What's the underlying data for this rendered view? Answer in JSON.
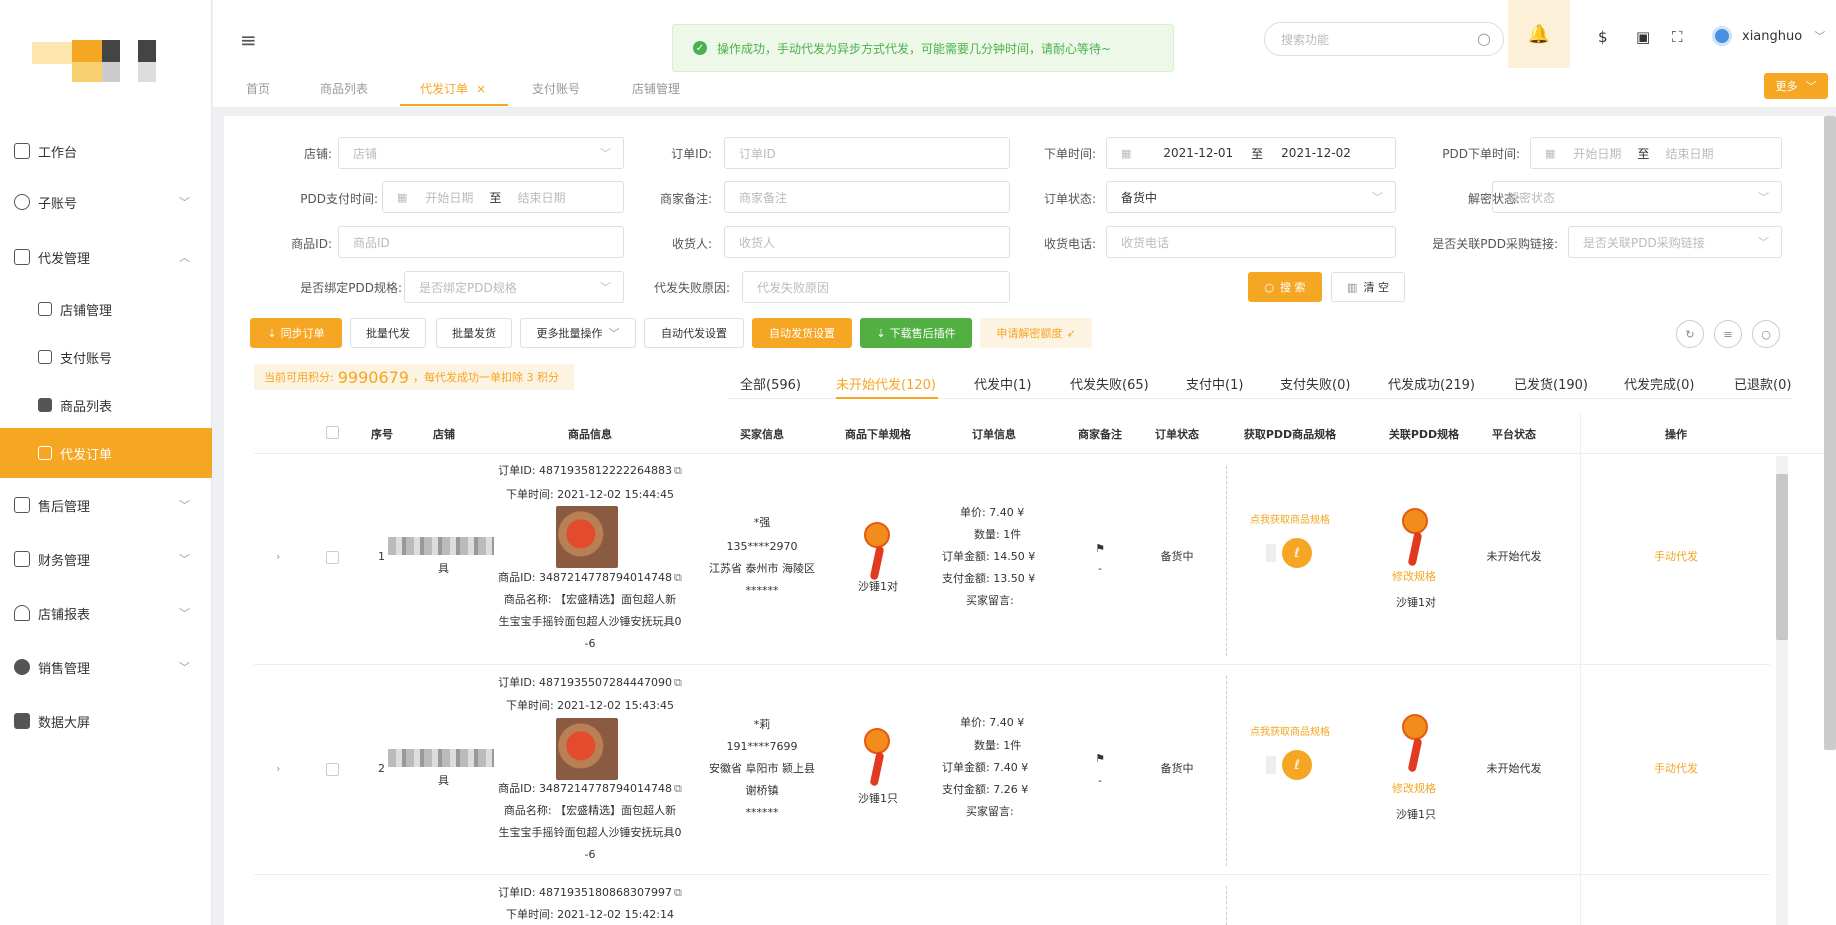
{
  "app": {
    "user": "xianghuo"
  },
  "header": {
    "toast": "操作成功，手动代发为异步方式代发，可能需要几分钟时间，请耐心等待~",
    "search_placeholder": "搜索功能",
    "more": "更多"
  },
  "page_tabs": [
    {
      "label": "首页"
    },
    {
      "label": "商品列表"
    },
    {
      "label": "代发订单",
      "close": "×"
    },
    {
      "label": "支付账号"
    },
    {
      "label": "店铺管理"
    }
  ],
  "sidebar": {
    "items": [
      {
        "label": "工作台"
      },
      {
        "label": "子账号"
      },
      {
        "label": "代发管理"
      },
      {
        "label": "店铺管理"
      },
      {
        "label": "支付账号"
      },
      {
        "label": "商品列表"
      },
      {
        "label": "代发订单"
      },
      {
        "label": "售后管理"
      },
      {
        "label": "财务管理"
      },
      {
        "label": "店铺报表"
      },
      {
        "label": "销售管理"
      },
      {
        "label": "数据大屏"
      }
    ]
  },
  "filters": {
    "shop": {
      "label": "店铺:",
      "placeholder": "店铺"
    },
    "order_id": {
      "label": "订单ID:",
      "placeholder": "订单ID"
    },
    "order_time": {
      "label": "下单时间:",
      "start": "2021-12-01",
      "end": "2021-12-02",
      "sep": "至"
    },
    "pdd_order_time": {
      "label": "PDD下单时间:",
      "start": "开始日期",
      "end": "结束日期",
      "sep": "至"
    },
    "pdd_pay_time": {
      "label": "PDD支付时间:",
      "start": "开始日期",
      "end": "结束日期",
      "sep": "至"
    },
    "merchant_note": {
      "label": "商家备注:",
      "placeholder": "商家备注"
    },
    "order_status": {
      "label": "订单状态:",
      "value": "备货中"
    },
    "decrypt_status": {
      "label": "解密状态:",
      "placeholder": "解密状态"
    },
    "product_id": {
      "label": "商品ID:",
      "placeholder": "商品ID"
    },
    "receiver": {
      "label": "收货人:",
      "placeholder": "收货人"
    },
    "receiver_phone": {
      "label": "收货电话:",
      "placeholder": "收货电话"
    },
    "pdd_link": {
      "label": "是否关联PDD采购链接:",
      "placeholder": "是否关联PDD采购链接"
    },
    "pdd_spec_bound": {
      "label": "是否绑定PDD规格:",
      "placeholder": "是否绑定PDD规格"
    },
    "fail_reason": {
      "label": "代发失败原因:",
      "placeholder": "代发失败原因"
    },
    "search_btn": "搜 索",
    "clear_btn": "清 空"
  },
  "actions": {
    "sync": "同步订单",
    "batch_dispatch": "批量代发",
    "batch_ship": "批量发货",
    "more_batch": "更多批量操作",
    "auto_dispatch": "自动代发设置",
    "auto_ship": "自动发货设置",
    "download_plugin": "下载售后插件",
    "apply_quota": "申请解密额度"
  },
  "points": {
    "prefix": "当前可用积分:",
    "value": "9990679",
    "suffix": "，每代发成功一单扣除 3 积分"
  },
  "status_tabs": [
    {
      "label": "全部(596)"
    },
    {
      "label": "未开始代发(120)"
    },
    {
      "label": "代发中(1)"
    },
    {
      "label": "代发失败(65)"
    },
    {
      "label": "支付中(1)"
    },
    {
      "label": "支付失败(0)"
    },
    {
      "label": "代发成功(219)"
    },
    {
      "label": "已发货(190)"
    },
    {
      "label": "代发完成(0)"
    },
    {
      "label": "已退款(0)"
    }
  ],
  "columns": [
    "序号",
    "店铺",
    "商品信息",
    "买家信息",
    "商品下单规格",
    "订单信息",
    "商家备注",
    "订单状态",
    "获取PDD商品规格",
    "关联PDD规格",
    "平台状态",
    "操作"
  ],
  "rows": [
    {
      "index": "1",
      "shop_suffix": "具",
      "order_id": "订单ID: 4871935812222264883",
      "order_time": "下单时间: 2021-12-02 15:44:45",
      "product_id": "商品ID: 3487214778794014748",
      "name1": "商品名称: 【宏盛精选】面包超人新",
      "name2": "生宝宝手摇铃面包超人沙锤安抚玩具0",
      "name3": "-6",
      "buyer_name": "*强",
      "buyer_phone": "135****2970",
      "buyer_addr": "江苏省 泰州市 海陵区",
      "buyer_stars": "******",
      "spec": "沙锤1对",
      "unit_price": "单价: 7.40 ¥",
      "qty": "数量: 1件",
      "order_amount": "订单金额: 14.50 ¥",
      "paid": "支付金额: 13.50 ¥",
      "msg": "买家留言:",
      "note": "-",
      "status": "备货中",
      "fetch_spec": "点我获取商品规格",
      "edit_spec": "修改规格",
      "linked_spec": "沙锤1对",
      "platform_status": "未开始代发",
      "op": "手动代发"
    },
    {
      "index": "2",
      "shop_suffix": "具",
      "order_id": "订单ID: 4871935507284447090",
      "order_time": "下单时间: 2021-12-02 15:43:45",
      "product_id": "商品ID: 3487214778794014748",
      "name1": "商品名称: 【宏盛精选】面包超人新",
      "name2": "生宝宝手摇铃面包超人沙锤安抚玩具0",
      "name3": "-6",
      "buyer_name": "*莉",
      "buyer_phone": "191****7699",
      "buyer_addr": "安徽省 阜阳市 颍上县",
      "buyer_addr2": "谢桥镇",
      "buyer_stars": "******",
      "spec": "沙锤1只",
      "unit_price": "单价: 7.40 ¥",
      "qty": "数量: 1件",
      "order_amount": "订单金额: 7.40 ¥",
      "paid": "支付金额: 7.26 ¥",
      "msg": "买家留言:",
      "note": "-",
      "status": "备货中",
      "fetch_spec": "点我获取商品规格",
      "edit_spec": "修改规格",
      "linked_spec": "沙锤1只",
      "platform_status": "未开始代发",
      "op": "手动代发"
    },
    {
      "order_id": "订单ID: 4871935180868307997",
      "order_time": "下单时间: 2021-12-02 15:42:14"
    }
  ],
  "icons": {
    "accent": "#f5a623",
    "success": "#4caf50",
    "green_btn": "#52b043"
  }
}
